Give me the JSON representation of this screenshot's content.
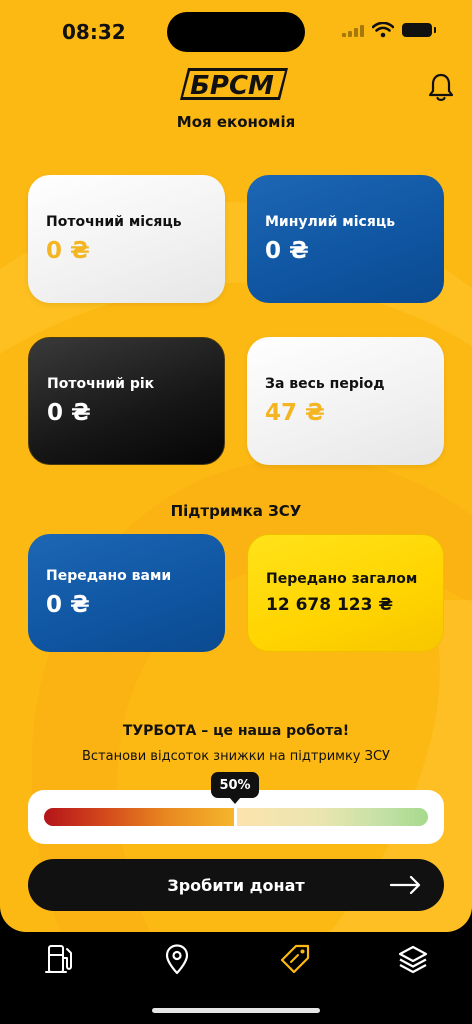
{
  "status": {
    "time": "08:32"
  },
  "header": {
    "logo_text": "БРСМ",
    "title": "Моя економія"
  },
  "savings": {
    "current_month": {
      "label": "Поточний місяць",
      "value": "0 ₴"
    },
    "last_month": {
      "label": "Минулий місяць",
      "value": "0 ₴"
    },
    "current_year": {
      "label": "Поточний рік",
      "value": "0 ₴"
    },
    "all_time": {
      "label": "За весь період",
      "value": "47 ₴"
    }
  },
  "support": {
    "title": "Підтримка ЗСУ",
    "by_you": {
      "label": "Передано вами",
      "value": "0 ₴"
    },
    "total": {
      "label": "Передано загалом",
      "value": "12 678 123 ₴"
    }
  },
  "promo": {
    "title": "ТУРБОТА – це наша робота!",
    "subtitle": "Встанови відсоток знижки на підтримку ЗСУ"
  },
  "slider": {
    "value_label": "50%",
    "value": 0.5
  },
  "donate": {
    "label": "Зробити донат"
  },
  "tabs": [
    {
      "icon": "fuel-station-icon",
      "active": false
    },
    {
      "icon": "map-pin-icon",
      "active": false
    },
    {
      "icon": "discount-tag-icon",
      "active": true
    },
    {
      "icon": "layers-icon",
      "active": false
    }
  ],
  "colors": {
    "background": "#FDB913",
    "accent_blue": "#0F55A1",
    "accent_gold": "#F4B522",
    "active_tab": "#FDB913"
  }
}
